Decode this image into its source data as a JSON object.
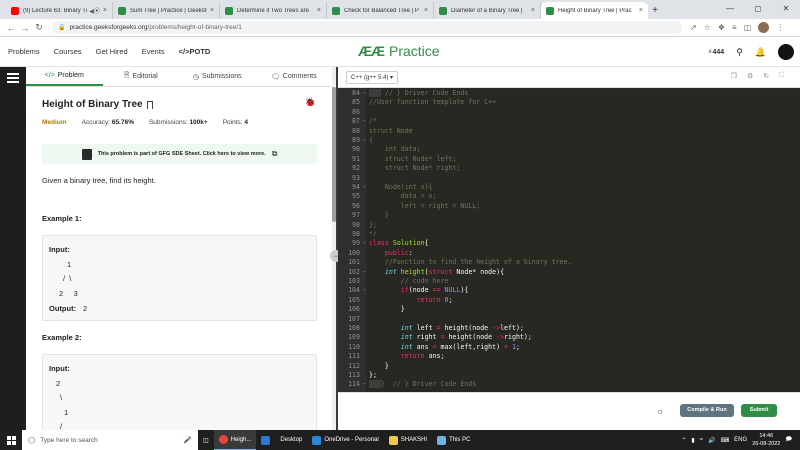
{
  "browser": {
    "tabs": [
      {
        "title": "(9) Lecture 63: Binary Tr",
        "icon_color": "#ff0000",
        "icon": "youtube-icon"
      },
      {
        "title": "Sum Tree | Practice | GeeksforG",
        "icon_color": "#2f8d46",
        "icon": "gfg-icon"
      },
      {
        "title": "Determine if Two Trees are",
        "icon_color": "#2f8d46",
        "icon": "gfg-icon"
      },
      {
        "title": "Check for Balanced Tree | P",
        "icon_color": "#2f8d46",
        "icon": "gfg-icon"
      },
      {
        "title": "Diameter of a Binary Tree |",
        "icon_color": "#2f8d46",
        "icon": "gfg-icon"
      },
      {
        "title": "Height of Binary Tree | Prac",
        "icon_color": "#2f8d46",
        "icon": "gfg-icon"
      }
    ],
    "url_host": "practice.geeksforgeeks.org",
    "url_path": "/problems/height-of-binary-tree/1"
  },
  "site": {
    "nav": [
      "Problems",
      "Courses",
      "Get Hired",
      "Events"
    ],
    "potd": "</>POTD",
    "logo_text": "Practice",
    "streak": "444",
    "brand_color": "#2f8d46"
  },
  "problem": {
    "tabs": [
      "Problem",
      "Editorial",
      "Submissions",
      "Comments"
    ],
    "title": "Height of Binary Tree",
    "difficulty": "Medium",
    "accuracy_label": "Accuracy:",
    "accuracy": "65.76%",
    "submissions_label": "Submissions:",
    "submissions": "100k+",
    "points_label": "Points:",
    "points": "4",
    "sde_banner": "This problem is part of GFG SDE Sheet. Click here to view more.",
    "description": "Given a binary tree, find its height.",
    "example1": {
      "heading": "Example 1:",
      "input_label": "Input:",
      "tree_lines": [
        "1",
        "/  \\",
        "2     3"
      ],
      "output_label": "Output:",
      "output": "2"
    },
    "example2": {
      "heading": "Example 2:",
      "input_label": "Input:",
      "tree_lines": [
        "2",
        "\\",
        "1",
        "/"
      ]
    }
  },
  "editor": {
    "language": "C++ (g++ 5.4)",
    "buttons": {
      "compile_run": "Compile & Run",
      "submit": "Submit"
    }
  },
  "taskbar": {
    "search_placeholder": "Type here to search",
    "items": [
      "Heigh...",
      "Desktop",
      "OneDrive - Personal",
      "SHAKSHI",
      "This PC"
    ],
    "lang": "ENG",
    "time": "14:46",
    "date": "26-08-2022"
  }
}
